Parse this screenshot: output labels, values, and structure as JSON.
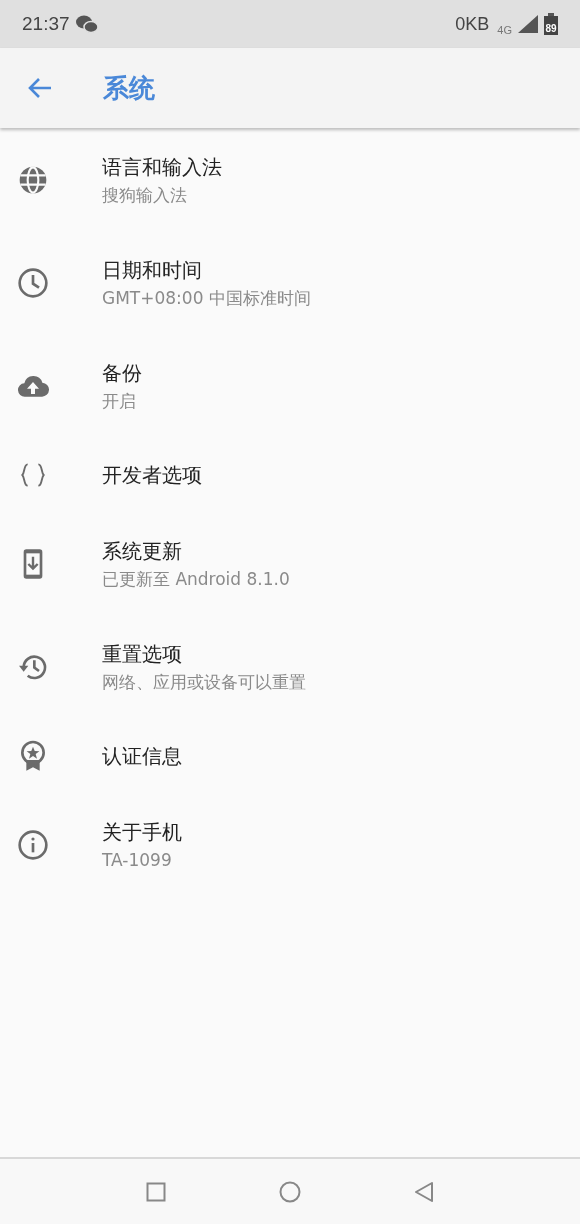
{
  "status_bar": {
    "time": "21:37",
    "data_rate": "0KB",
    "network": "4G",
    "battery": "89"
  },
  "app_bar": {
    "title": "系统"
  },
  "items": [
    {
      "title": "语言和输入法",
      "subtitle": "搜狗输入法"
    },
    {
      "title": "日期和时间",
      "subtitle": "GMT+08:00 中国标准时间"
    },
    {
      "title": "备份",
      "subtitle": "开启"
    },
    {
      "title": "开发者选项"
    },
    {
      "title": "系统更新",
      "subtitle": "已更新至 Android 8.1.0"
    },
    {
      "title": "重置选项",
      "subtitle": "网络、应用或设备可以重置"
    },
    {
      "title": "认证信息"
    },
    {
      "title": "关于手机",
      "subtitle": "TA-1099"
    }
  ]
}
